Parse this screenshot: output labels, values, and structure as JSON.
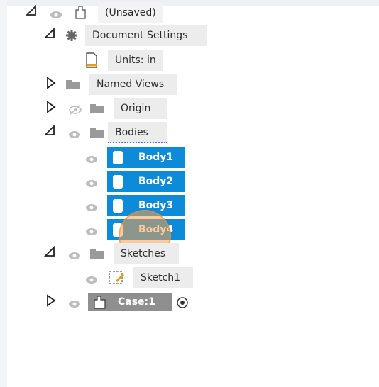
{
  "browser": {
    "root": {
      "label": "(Unsaved)"
    },
    "doc_settings": {
      "label": "Document Settings"
    },
    "units": {
      "label": "Units: in"
    },
    "named_views": {
      "label": "Named Views"
    },
    "origin": {
      "label": "Origin"
    },
    "bodies": {
      "label": "Bodies"
    },
    "body_items": [
      {
        "label": "Body1"
      },
      {
        "label": "Body2"
      },
      {
        "label": "Body3"
      },
      {
        "label": "Body4"
      }
    ],
    "sketches": {
      "label": "Sketches"
    },
    "sketch_items": [
      {
        "label": "Sketch1"
      }
    ],
    "component": {
      "label": "Case:1"
    }
  },
  "colors": {
    "selection": "#0d8bd9",
    "cursor_highlight": "#f7a04b"
  }
}
